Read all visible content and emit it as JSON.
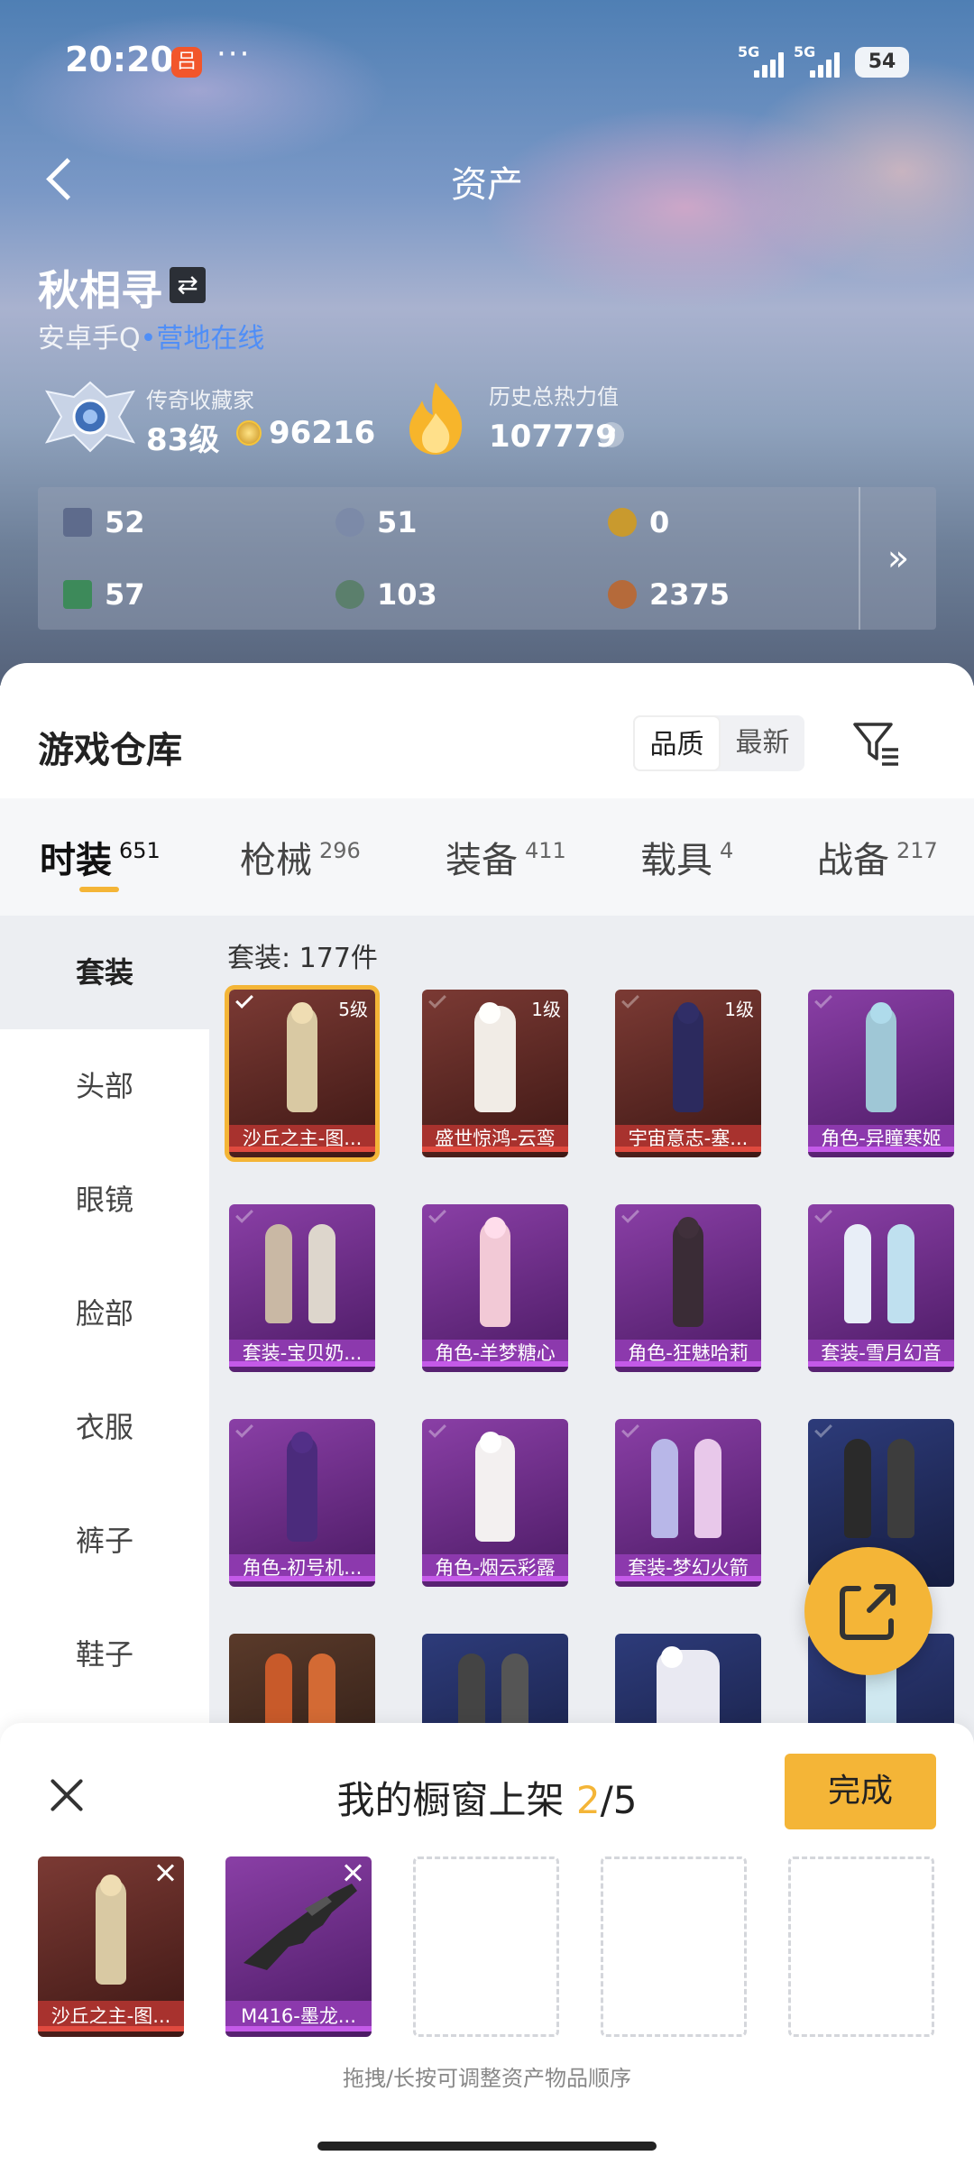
{
  "status": {
    "time": "20:20",
    "app_badge": "吕",
    "dots": "···",
    "network1": "5G",
    "network2": "5G",
    "battery": "54"
  },
  "header": {
    "title": "资产"
  },
  "profile": {
    "name": "秋相寻",
    "platform": "安卓手Q",
    "online": "营地在线",
    "legend_label": "传奇收藏家",
    "legend_level": "83级",
    "legend_coins": "96216",
    "heat_label": "历史总热力值",
    "heat_value": "107779",
    "help": "?"
  },
  "stats": [
    {
      "icon": "card-icon",
      "value": "52",
      "color": "#5e6b8c"
    },
    {
      "icon": "ring-icon",
      "value": "51",
      "color": "#7c8aa8"
    },
    {
      "icon": "gold-badge-icon",
      "value": "0",
      "color": "#c99a2e"
    },
    {
      "icon": "green-card-icon",
      "value": "57",
      "color": "#3d8a5a"
    },
    {
      "icon": "orb-icon",
      "value": "103",
      "color": "#5b7f6c"
    },
    {
      "icon": "bronze-badge-icon",
      "value": "2375",
      "color": "#b56a3a"
    }
  ],
  "stats_more": "»",
  "warehouse": {
    "title": "游戏仓库",
    "sort_quality": "品质",
    "sort_latest": "最新"
  },
  "tabs": [
    {
      "label": "时装",
      "count": "651"
    },
    {
      "label": "枪械",
      "count": "296"
    },
    {
      "label": "装备",
      "count": "411"
    },
    {
      "label": "载具",
      "count": "4"
    },
    {
      "label": "战备",
      "count": "217"
    }
  ],
  "categories": [
    "套装",
    "头部",
    "眼镜",
    "脸部",
    "衣服",
    "裤子",
    "鞋子"
  ],
  "grid": {
    "count_label": "套装: 177件",
    "items": [
      {
        "name": "沙丘之主-图...",
        "level": "5级",
        "rarity": "red",
        "selected": true
      },
      {
        "name": "盛世惊鸿-云鸾",
        "level": "1级",
        "rarity": "red",
        "selected": false
      },
      {
        "name": "宇宙意志-塞...",
        "level": "1级",
        "rarity": "red",
        "selected": false
      },
      {
        "name": "角色-异瞳寒姬",
        "level": "",
        "rarity": "purple",
        "selected": false
      },
      {
        "name": "套装-宝贝奶...",
        "level": "",
        "rarity": "purple",
        "selected": false
      },
      {
        "name": "角色-羊梦糖心",
        "level": "",
        "rarity": "purple",
        "selected": false
      },
      {
        "name": "角色-狂魅哈莉",
        "level": "",
        "rarity": "purple",
        "selected": false
      },
      {
        "name": "套装-雪月幻音",
        "level": "",
        "rarity": "purple",
        "selected": false
      },
      {
        "name": "角色-初号机...",
        "level": "",
        "rarity": "purple",
        "selected": false
      },
      {
        "name": "角色-烟云彩露",
        "level": "",
        "rarity": "purple",
        "selected": false
      },
      {
        "name": "套装-梦幻火箭",
        "level": "",
        "rarity": "purple",
        "selected": false
      },
      {
        "name": "",
        "level": "",
        "rarity": "blue",
        "selected": false
      }
    ]
  },
  "showcase": {
    "title": "我的橱窗上架",
    "current": "2",
    "total": "/5",
    "done": "完成",
    "slots": [
      {
        "name": "沙丘之主-图...",
        "rarity": "red"
      },
      {
        "name": "M416-墨龙...",
        "rarity": "purple"
      }
    ],
    "hint": "拖拽/长按可调整资产物品顺序"
  },
  "colors": {
    "accent": "#f4b537",
    "online": "#4f8ef7",
    "red_rarity": "#a8322e",
    "purple_rarity": "#8c39ad"
  }
}
